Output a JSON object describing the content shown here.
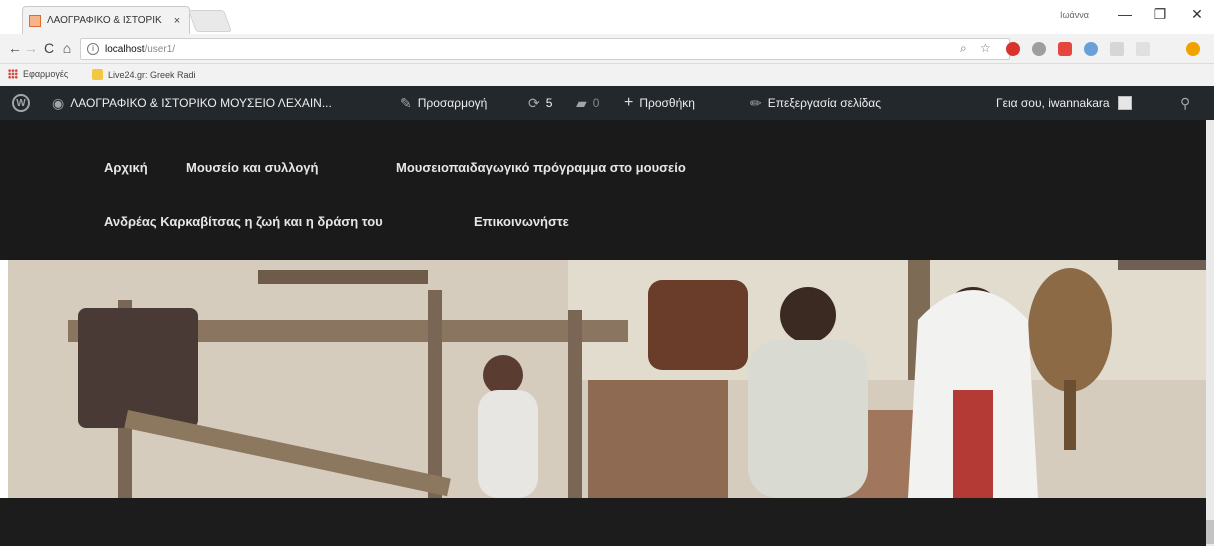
{
  "browser": {
    "tab_title": "ΛΑΟΓΡΑΦΙΚΟ & ΙΣΤΟΡΙΚ",
    "tab_close": "×",
    "window_user": "Ιωάννα",
    "minimize": "—",
    "maximize": "❐",
    "close": "✕",
    "back": "←",
    "forward": "→",
    "reload": "C",
    "home": "⌂",
    "url_host": "localhost",
    "url_path": "/user1/",
    "bookmarks": [
      {
        "label": "Εφαρμογές"
      },
      {
        "label": "Live24.gr: Greek Radi"
      }
    ]
  },
  "admin_bar": {
    "site_name": "ΛΑΟΓΡΑΦΙΚΟ & ΙΣΤΟΡΙΚΟ ΜΟΥΣΕΙΟ ΛΕΧΑΙΝ...",
    "customize": "Προσαρμογή",
    "updates_count": "5",
    "comments_count": "0",
    "new": "Προσθήκη",
    "edit_page": "Επεξεργασία σελίδας",
    "greeting": "Γεια σου, iwannakara"
  },
  "menu": {
    "row1": [
      "Αρχική",
      "Μουσείο και συλλογή",
      "Μουσειοπαιδαγωγικό πρόγραμμα στο μουσείο"
    ],
    "row2": [
      "Ανδρέας Καρκαβίτσας η ζωή και η δράση του",
      "Επικοινωνήστε"
    ]
  },
  "colors": {
    "admin_bar": "#23282d",
    "header": "#1a1a1a",
    "menu_text": "#e6e6e6"
  }
}
